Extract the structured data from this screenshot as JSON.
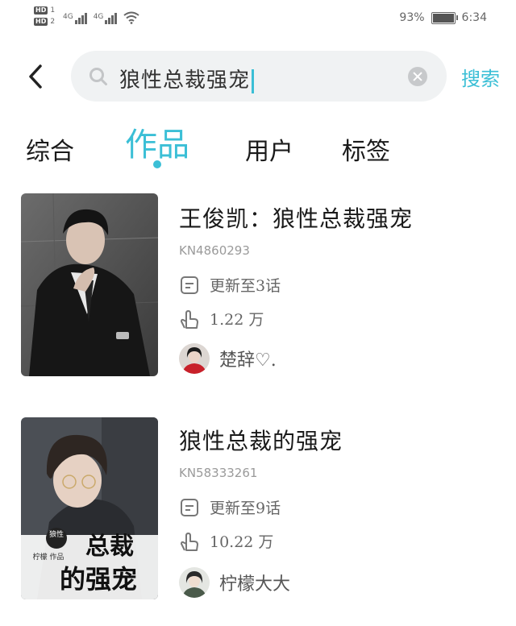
{
  "status_bar": {
    "hd1": "HD",
    "hd1_num": "1",
    "hd2": "HD",
    "hd2_num": "2",
    "signal1": "4G",
    "signal2": "4G",
    "battery_percent": "93%",
    "battery_level": 0.93,
    "time": "6:34"
  },
  "search": {
    "query": "狼性总裁强宠",
    "submit_label": "搜索"
  },
  "tabs": [
    {
      "label": "综合",
      "active": false
    },
    {
      "label": "作品",
      "active": true
    },
    {
      "label": "用户",
      "active": false
    },
    {
      "label": "标签",
      "active": false
    }
  ],
  "results": [
    {
      "title": "王俊凯：狼性总裁强宠",
      "code": "KN4860293",
      "update": "更新至3话",
      "likes": "1.22 万",
      "author": "楚辞♡."
    },
    {
      "title": "狼性总裁的强宠",
      "code": "KN58333261",
      "update": "更新至9话",
      "likes": "10.22 万",
      "author": "柠檬大大",
      "cover_text": {
        "wolf": "狼性",
        "small": "柠檬 作品",
        "line1": "总裁",
        "line2": "的强宠"
      }
    }
  ],
  "colors": {
    "accent": "#3bbfd6",
    "search_bg": "#f0f2f3",
    "text": "#1a1a1a",
    "muted": "#9a9a9a"
  }
}
